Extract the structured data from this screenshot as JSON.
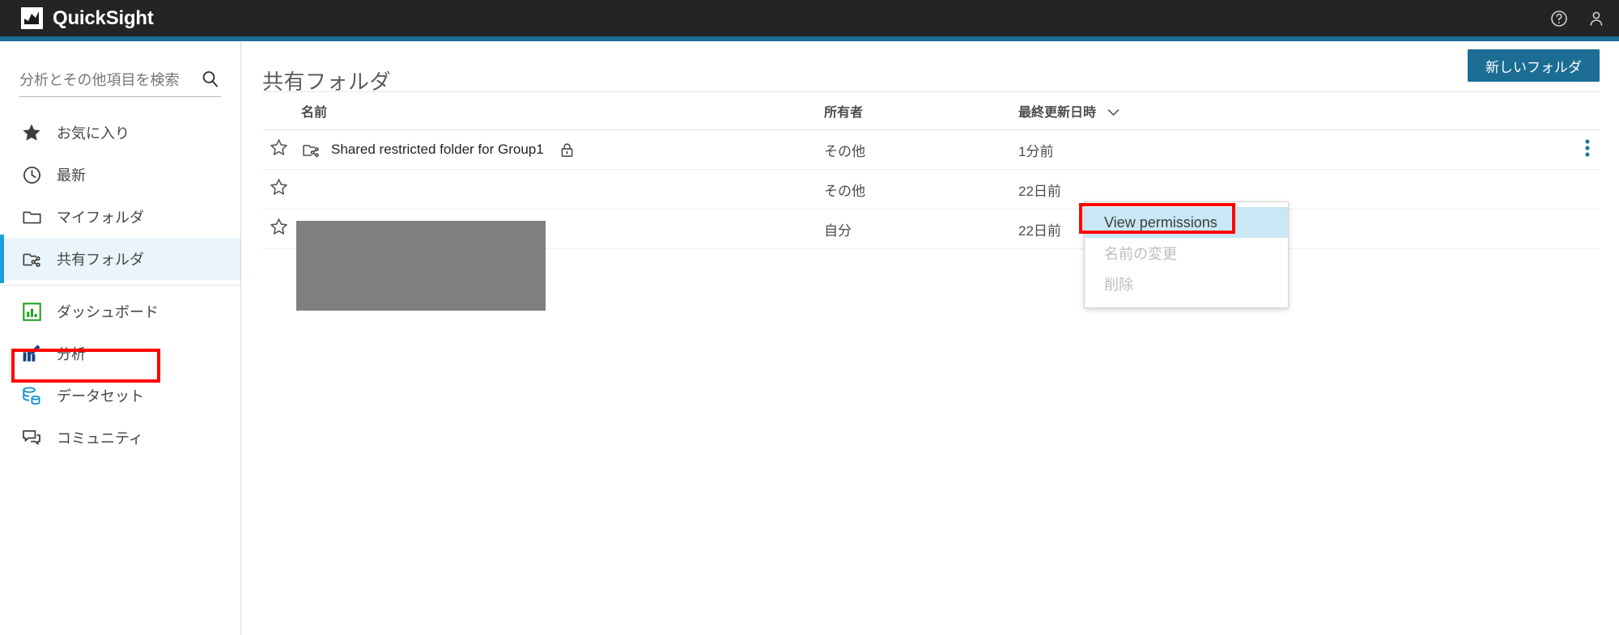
{
  "app": {
    "brand_name": "QuickSight",
    "logo_icon": "chart-logo-icon",
    "help_icon": "help-circle-icon",
    "account_icon": "user-account-icon",
    "accent_color": "#1b6d94",
    "topbar_color": "#242424",
    "active_highlight_color": "#eaf5fb",
    "annotation_color": "#ff0000"
  },
  "sidebar": {
    "search": {
      "placeholder": "分析とその他項目を検索",
      "value": "",
      "icon": "search-icon"
    },
    "items": [
      {
        "label": "お気に入り",
        "icon": "star-filled-icon",
        "active": false
      },
      {
        "label": "最新",
        "icon": "clock-icon",
        "active": false
      },
      {
        "label": "マイフォルダ",
        "icon": "folder-icon",
        "active": false
      },
      {
        "label": "共有フォルダ",
        "icon": "shared-folder-icon",
        "active": true
      },
      {
        "label": "ダッシュボード",
        "icon": "dashboard-bar-chart-icon",
        "active": false
      },
      {
        "label": "分析",
        "icon": "analysis-pencil-chart-icon",
        "active": false
      },
      {
        "label": "データセット",
        "icon": "dataset-database-icon",
        "active": false
      },
      {
        "label": "コミュニティ",
        "icon": "community-chat-icon",
        "active": false
      }
    ]
  },
  "main": {
    "title": "共有フォルダ",
    "new_folder_label": "新しいフォルダ",
    "table": {
      "columns": [
        "名前",
        "所有者",
        "最終更新日時"
      ],
      "sort_icon": "chevron-down-icon",
      "rows": [
        {
          "star_icon": "star-outline-icon",
          "type_icon": "shared-folder-icon",
          "name": "Shared restricted folder for Group1",
          "lock_icon": "lock-icon",
          "owner": "その他",
          "modified": "1分前",
          "menu_icon": "kebab-menu-icon",
          "redacted": false
        },
        {
          "star_icon": "star-outline-icon",
          "type_icon": "shared-folder-icon",
          "name": "",
          "lock_icon": "",
          "owner": "その他",
          "modified": "22日前",
          "menu_icon": "kebab-menu-icon",
          "redacted": true
        },
        {
          "star_icon": "star-outline-icon",
          "type_icon": "shared-folder-icon",
          "name": "",
          "lock_icon": "",
          "owner": "自分",
          "modified": "22日前",
          "menu_icon": "kebab-menu-icon",
          "redacted": true
        }
      ]
    }
  },
  "context_menu": {
    "items": [
      {
        "label": "View permissions",
        "state": "highlighted"
      },
      {
        "label": "名前の変更",
        "state": "disabled"
      },
      {
        "label": "削除",
        "state": "disabled"
      }
    ]
  }
}
